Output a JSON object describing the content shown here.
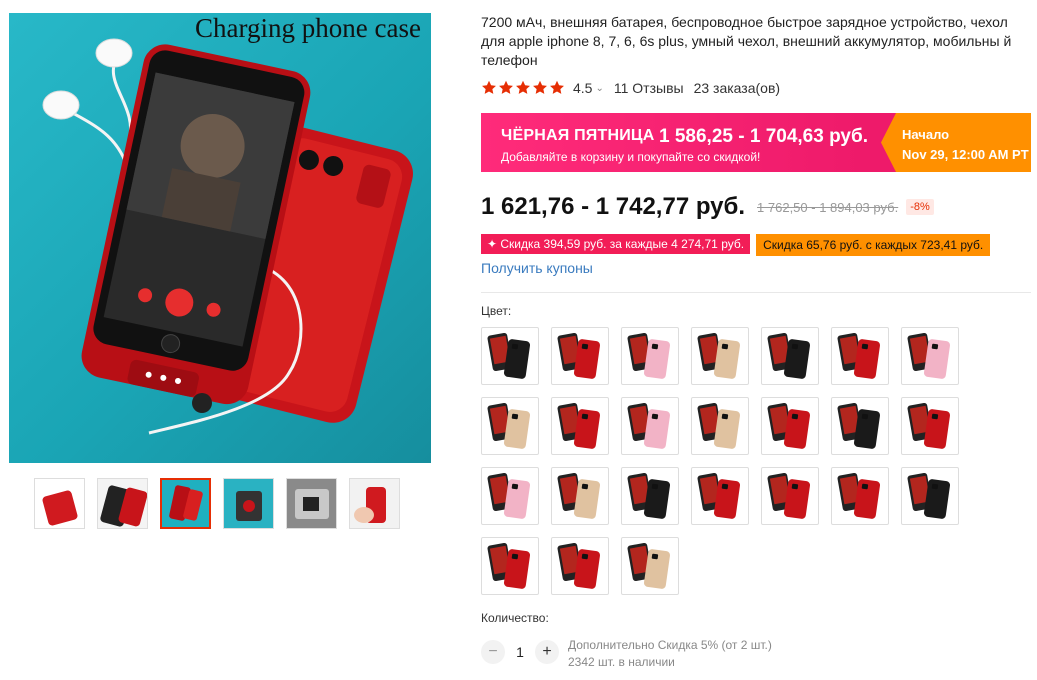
{
  "gallery": {
    "caption": "Charging phone case",
    "thumbnail_count": 6,
    "active_thumbnail": 3
  },
  "product": {
    "title": "7200 мАч, внешняя батарея, беспроводное быстрое зарядное устройство, чехол для apple iphone 8, 7, 6, 6s plus, умный чехол, внешний аккумулятор, мобильны й телефон",
    "rating": "4.5",
    "reviews": "11 Отзывы",
    "orders": "23 заказа(ов)"
  },
  "promo": {
    "label": "ЧЁРНАЯ ПЯТНИЦА",
    "price": "1 586,25 - 1 704,63 руб.",
    "subtext": "Добавляйте в корзину и покупайте со скидкой!",
    "start_label": "Начало",
    "start_date": "Nov 29, 12:00 AM PT"
  },
  "pricing": {
    "current": "1 621,76 - 1 742,77 руб.",
    "old": "1 762,50 - 1 894,03 руб.",
    "discount": "-8%"
  },
  "coupons": {
    "first": "Скидка 394,59 руб. за каждые 4 274,71 руб.",
    "second": "Скидка 65,76 руб. с каждых 723,41 руб.",
    "get": "Получить купоны"
  },
  "color": {
    "label": "Цвет:",
    "swatches": [
      "black",
      "red",
      "pink",
      "gold",
      "black",
      "red",
      "pink",
      "gold",
      "red",
      "pink",
      "gold",
      "red",
      "black",
      "red",
      "pink",
      "gold",
      "black",
      "red",
      "red",
      "red",
      "black",
      "red",
      "red",
      "gold"
    ]
  },
  "quantity": {
    "label": "Количество:",
    "value": "1",
    "bulk": "Дополнительно Скидка 5% (от 2 шт.)",
    "stock": "2342 шт. в наличии"
  },
  "colors": {
    "accent": "#e62e04",
    "promo_pink": "#ff2b7a",
    "promo_orange": "#ff9000",
    "link": "#3a7bbf"
  }
}
